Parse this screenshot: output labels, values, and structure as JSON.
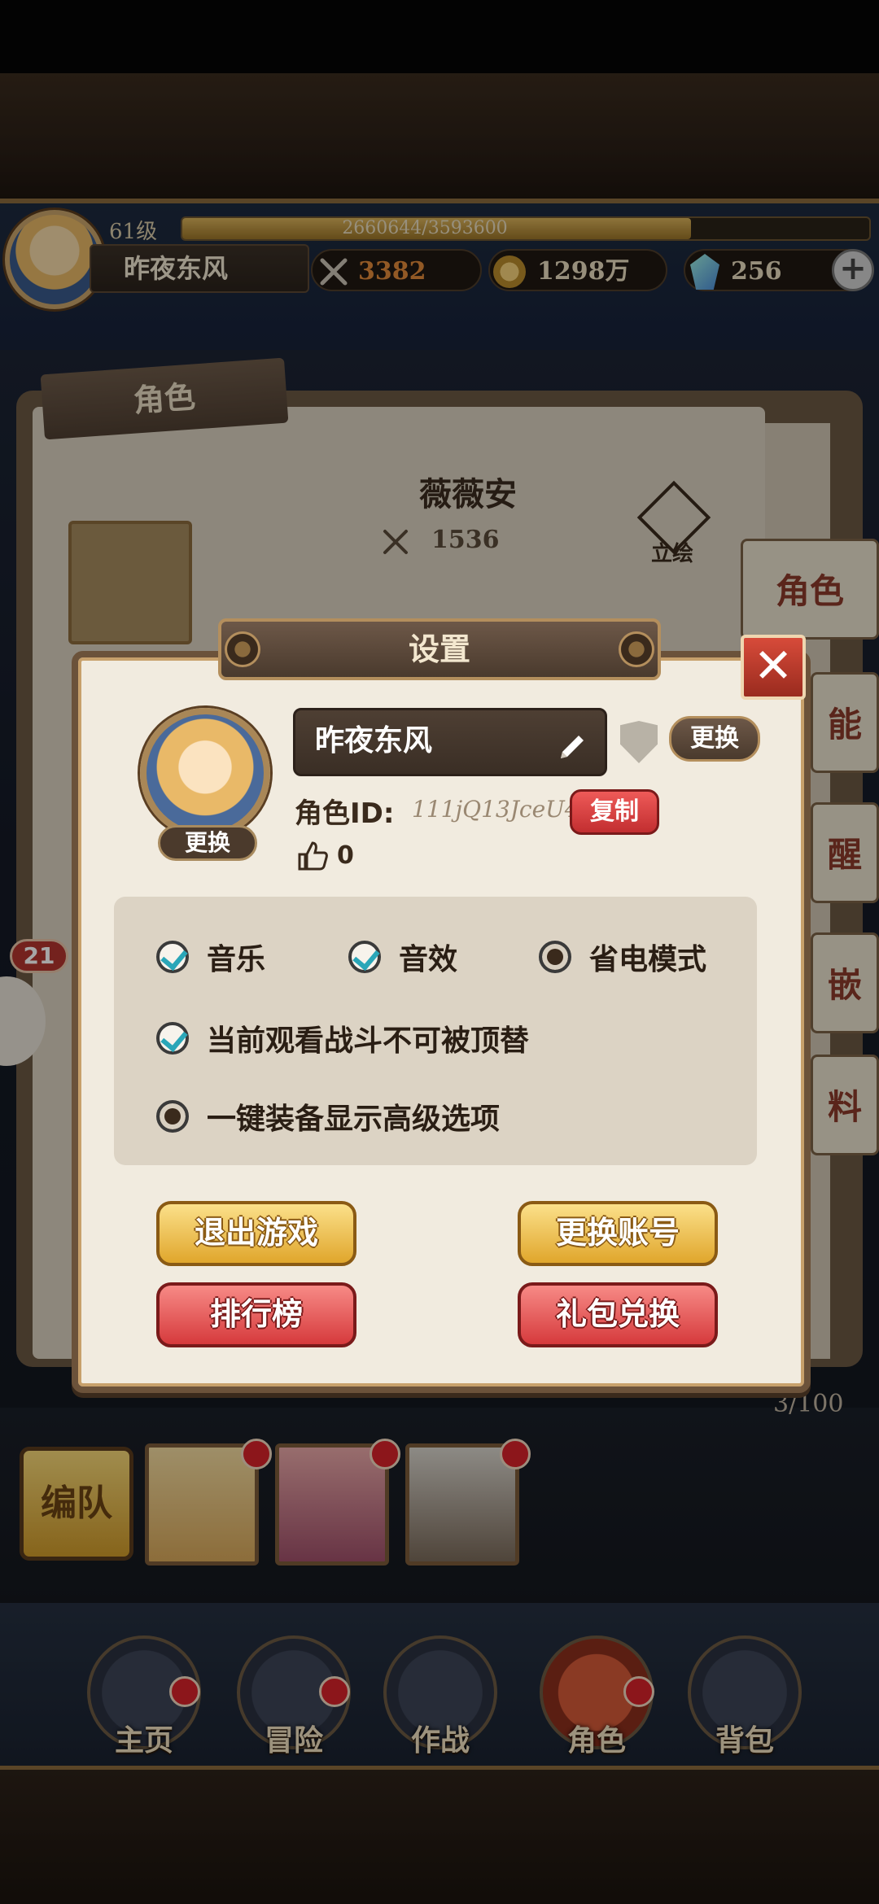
{
  "player": {
    "level": "61级",
    "xp": "2660644/3593600",
    "xp_fraction": 0.74,
    "name": "昨夜东风",
    "power": "3382",
    "gold": "1298万",
    "gems": "256",
    "plus": "+"
  },
  "background": {
    "panel_tab": "角色",
    "hero_name": "薇薇安",
    "hero_power": "1536",
    "illustration_label": "立绘",
    "side_tabs": [
      "角色",
      "能",
      "醒",
      "嵌",
      "料"
    ],
    "badge": "21",
    "team_count": "3/100",
    "team_button": "编队"
  },
  "dialog": {
    "title": "设置",
    "close": "✕",
    "avatar_change": "更换",
    "name": "昨夜东风",
    "name_change": "更换",
    "id_label": "角色ID:",
    "id_value": "111jQ13JceU4",
    "copy": "复制",
    "likes": "0",
    "options": {
      "music": {
        "label": "音乐",
        "checked": true
      },
      "sound": {
        "label": "音效",
        "checked": true
      },
      "power_save": {
        "label": "省电模式",
        "checked": false
      },
      "no_replace": {
        "label": "当前观看战斗不可被顶替",
        "checked": true
      },
      "advanced_equip": {
        "label": "一键装备显示高级选项",
        "checked": false
      }
    },
    "buttons": {
      "exit_game": "退出游戏",
      "switch_account": "更换账号",
      "leaderboard": "排行榜",
      "gift_redeem": "礼包兑换"
    }
  },
  "nav": [
    {
      "label": "主页"
    },
    {
      "label": "冒险"
    },
    {
      "label": "作战"
    },
    {
      "label": "角色",
      "active": true
    },
    {
      "label": "背包"
    }
  ],
  "colors": {
    "accent_gold": "#e0a62c",
    "accent_red": "#d63a3c",
    "check_teal": "#2aa6b8",
    "dialog_bg": "#f1ebdf"
  }
}
